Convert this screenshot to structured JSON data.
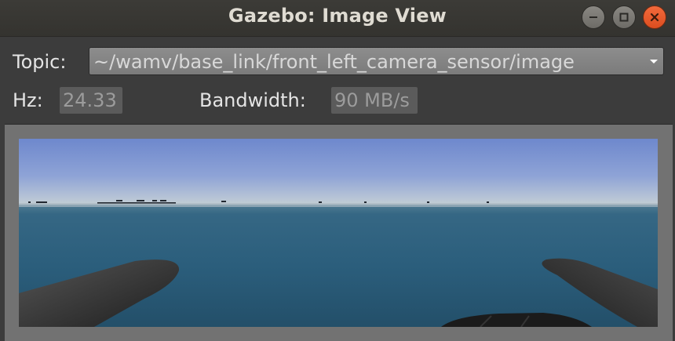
{
  "window": {
    "title": "Gazebo: Image View",
    "controls": {
      "minimize": "minimize-icon",
      "maximize": "maximize-icon",
      "close": "close-icon"
    },
    "close_color": "#e95420"
  },
  "topic": {
    "label": "Topic:",
    "selected": "~/wamv/base_link/front_left_camera_sensor/image"
  },
  "stats": {
    "hz_label": "Hz:",
    "hz_value": "24.33",
    "bandwidth_label": "Bandwidth:",
    "bandwidth_value": "90 MB/s"
  },
  "camera_image": {
    "description_colors": {
      "sky_top": "#6e88cd",
      "sky_horizon": "#b9c6cf",
      "water": "#2b5d7b",
      "hull": "#3a3a3a"
    }
  }
}
